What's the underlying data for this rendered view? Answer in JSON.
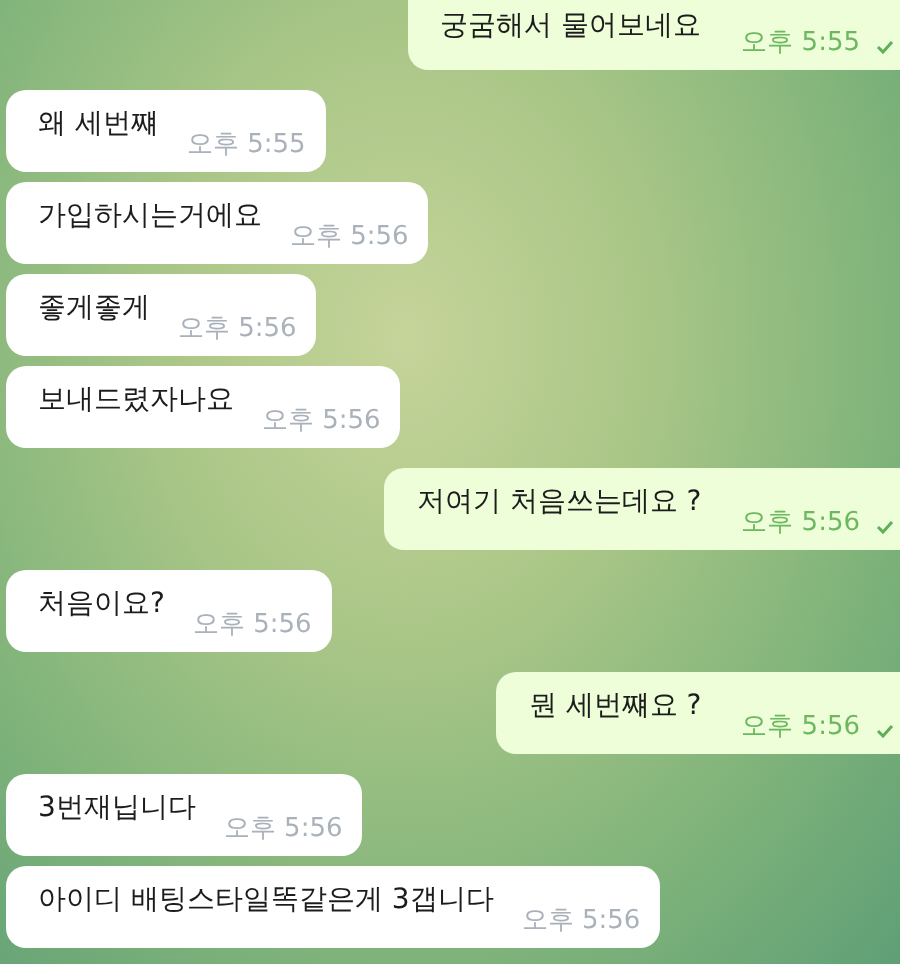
{
  "messages": [
    {
      "kind": "out",
      "text": "궁굼해서 물어보네요",
      "time": "오후 5:55",
      "read": false,
      "cut_top": true
    },
    {
      "kind": "in",
      "text": "왜 세번쨰",
      "time": "오후 5:55"
    },
    {
      "kind": "in",
      "text": "가입하시는거에요",
      "time": "오후 5:56"
    },
    {
      "kind": "in",
      "text": "좋게좋게",
      "time": "오후 5:56"
    },
    {
      "kind": "in",
      "text": "보내드렸자나요",
      "time": "오후 5:56"
    },
    {
      "kind": "out",
      "text": "저여기 처음쓰는데요 ?",
      "time": "오후 5:56",
      "read": false
    },
    {
      "kind": "in",
      "text": "처음이요?",
      "time": "오후 5:56"
    },
    {
      "kind": "out",
      "text": "뭔 세번쨰요 ?",
      "time": "오후 5:56",
      "read": false
    },
    {
      "kind": "in",
      "text": "3번재닙니다",
      "time": "오후 5:56"
    },
    {
      "kind": "in",
      "text": "아이디 배팅스타일똑같은게 3갭니다",
      "time": "오후 5:56"
    }
  ]
}
